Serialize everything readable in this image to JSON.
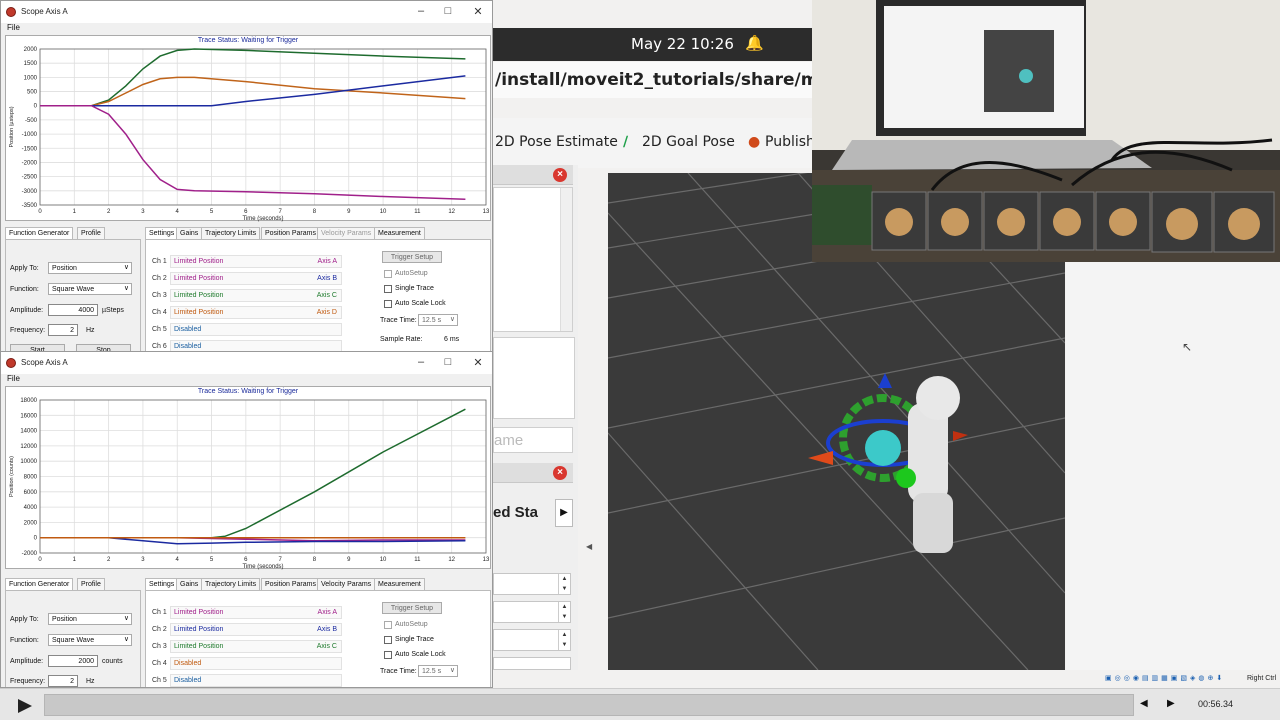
{
  "ubuntu": {
    "clock": "May 22  10:26"
  },
  "rviz": {
    "path": "/install/moveit2_tutorials/share/moveit2_",
    "tools": [
      "2D Pose Estimate",
      "2D Goal Pose",
      "Publish P"
    ],
    "partial_text_1": "ame",
    "partial_text_2": "ed Sta"
  },
  "video": {
    "time": "00:56.34",
    "right_ctrl": "Right Ctrl"
  },
  "scope1": {
    "title": "Scope Axis A",
    "menu": "File",
    "trace_status": "Trace Status:  Waiting for Trigger",
    "ylabel": "Position (µsteps)",
    "xlabel": "Time (seconds)",
    "fg_tabs": [
      "Function Generator",
      "Profile"
    ],
    "set_tabs": [
      "Settings",
      "Gains",
      "Trajectory Limits",
      "Position Params",
      "Velocity Params",
      "Measurement"
    ],
    "apply_to_label": "Apply To:",
    "apply_to": "Position",
    "function_label": "Function:",
    "function": "Square Wave",
    "amplitude_label": "Amplitude:",
    "amplitude": "4000",
    "amplitude_unit": "µSteps",
    "frequency_label": "Frequency:",
    "frequency": "2",
    "frequency_unit": "Hz",
    "start": "Start",
    "stop": "Stop",
    "channels": [
      {
        "ch": "Ch 1",
        "value": "Limited Position",
        "axis": "Axis A",
        "color": "#a0208a"
      },
      {
        "ch": "Ch 2",
        "value": "Limited Position",
        "axis": "Axis B",
        "color": "#1b2aa0"
      },
      {
        "ch": "Ch 3",
        "value": "Limited Position",
        "axis": "Axis C",
        "color": "#1e7a2c"
      },
      {
        "ch": "Ch 4",
        "value": "Limited Position",
        "axis": "Axis D",
        "color": "#c05a10"
      },
      {
        "ch": "Ch 5",
        "value": "Disabled",
        "axis": "",
        "color": "#1b5fa0"
      },
      {
        "ch": "Ch 6",
        "value": "Disabled",
        "axis": "",
        "color": "#1b5fa0"
      }
    ],
    "trigger_setup": "Trigger Setup",
    "autosetup": "AutoSetup",
    "single_trace": "Single Trace",
    "auto_scale_lock": "Auto Scale Lock",
    "trace_time_label": "Trace Time:",
    "trace_time": "12.5 s",
    "sample_rate_label": "Sample Rate:",
    "sample_rate": "6 ms"
  },
  "scope2": {
    "title": "Scope Axis A",
    "menu": "File",
    "trace_status": "Trace Status:  Waiting for Trigger",
    "ylabel": "Position (counts)",
    "xlabel": "Time (seconds)",
    "fg_tabs": [
      "Function Generator",
      "Profile"
    ],
    "set_tabs": [
      "Settings",
      "Gains",
      "Trajectory Limits",
      "Position Params",
      "Velocity Params",
      "Measurement"
    ],
    "apply_to_label": "Apply To:",
    "apply_to": "Position",
    "function_label": "Function:",
    "function": "Square Wave",
    "amplitude_label": "Amplitude:",
    "amplitude": "2000",
    "amplitude_unit": "counts",
    "frequency_label": "Frequency:",
    "frequency": "2",
    "frequency_unit": "Hz",
    "channels": [
      {
        "ch": "Ch 1",
        "value": "Limited Position",
        "axis": "Axis A",
        "color": "#a0208a"
      },
      {
        "ch": "Ch 2",
        "value": "Limited Position",
        "axis": "Axis B",
        "color": "#1b2aa0"
      },
      {
        "ch": "Ch 3",
        "value": "Limited Position",
        "axis": "Axis C",
        "color": "#1e7a2c"
      },
      {
        "ch": "Ch 4",
        "value": "Disabled",
        "axis": "",
        "color": "#c05a10"
      },
      {
        "ch": "Ch 5",
        "value": "Disabled",
        "axis": "",
        "color": "#1b5fa0"
      }
    ],
    "trigger_setup": "Trigger Setup",
    "autosetup": "AutoSetup",
    "single_trace": "Single Trace",
    "auto_scale_lock": "Auto Scale Lock",
    "trace_time_label": "Trace Time:",
    "trace_time": "12.5 s"
  },
  "chart_data": [
    {
      "type": "line",
      "title": "Trace Status:  Waiting for Trigger",
      "xlabel": "Time (seconds)",
      "ylabel": "Position (µsteps)",
      "xlim": [
        0,
        13
      ],
      "ylim": [
        -3500,
        2000
      ],
      "xticks": [
        0,
        1,
        2,
        3,
        4,
        5,
        6,
        7,
        8,
        9,
        10,
        11,
        12,
        13
      ],
      "yticks": [
        -3500,
        -3000,
        -2500,
        -2000,
        -1500,
        -1000,
        -500,
        0,
        500,
        1000,
        1500,
        2000
      ],
      "grid": true,
      "series": [
        {
          "color": "#1e6b2e",
          "x": [
            0,
            1.5,
            2,
            2.5,
            3,
            3.5,
            4,
            4.5,
            6,
            8,
            10,
            12.4
          ],
          "y": [
            0,
            0,
            200,
            700,
            1300,
            1750,
            1950,
            2000,
            1950,
            1850,
            1750,
            1650
          ]
        },
        {
          "color": "#c0641a",
          "x": [
            0,
            1.5,
            2,
            2.5,
            3,
            3.5,
            4,
            4.5,
            6,
            8,
            10,
            12.4
          ],
          "y": [
            0,
            0,
            150,
            450,
            750,
            950,
            1000,
            1000,
            850,
            600,
            450,
            250
          ]
        },
        {
          "color": "#1b2aa0",
          "x": [
            0,
            5,
            6,
            8,
            10,
            12.4
          ],
          "y": [
            0,
            0,
            150,
            400,
            700,
            1050
          ]
        },
        {
          "color": "#a0208a",
          "x": [
            0,
            1.5,
            2,
            2.5,
            3,
            3.5,
            4,
            4.5,
            6,
            8,
            10,
            12.4
          ],
          "y": [
            0,
            0,
            -300,
            -1000,
            -1900,
            -2600,
            -2950,
            -3000,
            -3030,
            -3100,
            -3200,
            -3300
          ]
        }
      ]
    },
    {
      "type": "line",
      "title": "Trace Status:  Waiting for Trigger",
      "xlabel": "Time (seconds)",
      "ylabel": "Position (counts)",
      "xlim": [
        0,
        13
      ],
      "ylim": [
        -2000,
        18000
      ],
      "xticks": [
        0,
        1,
        2,
        3,
        4,
        5,
        6,
        7,
        8,
        9,
        10,
        11,
        12,
        13
      ],
      "yticks": [
        -2000,
        0,
        2000,
        4000,
        6000,
        8000,
        10000,
        12000,
        14000,
        16000,
        18000
      ],
      "grid": true,
      "series": [
        {
          "color": "#1e6b2e",
          "x": [
            0,
            5,
            5.4,
            6,
            8,
            10,
            12.4
          ],
          "y": [
            0,
            0,
            200,
            1200,
            6000,
            11200,
            16800
          ]
        },
        {
          "color": "#a0208a",
          "x": [
            0,
            4,
            6,
            8,
            10,
            12.4
          ],
          "y": [
            0,
            0,
            -200,
            -400,
            -300,
            -300
          ]
        },
        {
          "color": "#1b2aa0",
          "x": [
            0,
            2,
            3,
            4,
            5,
            6,
            8,
            10,
            12.4
          ],
          "y": [
            0,
            0,
            -400,
            -800,
            -700,
            -600,
            -500,
            -500,
            -400
          ]
        },
        {
          "color": "#c05a10",
          "x": [
            0,
            12.4
          ],
          "y": [
            0,
            0
          ]
        }
      ]
    }
  ]
}
